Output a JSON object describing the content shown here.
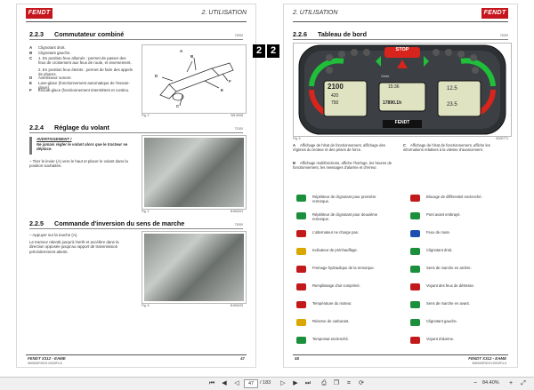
{
  "left_page": {
    "header_logo": "FENDT",
    "header_chapter": "2. UTILISATION",
    "sec1": {
      "num": "2.2.3",
      "title": "Commutateur combiné",
      "code": "72000",
      "items": [
        {
          "k": "A",
          "t": "Clignotant droit."
        },
        {
          "k": "B",
          "t": "Clignotant gauche."
        },
        {
          "k": "C",
          "t": "1. En position feux allumés : permet de passer des feux de croisement aux feux de route, et inversement."
        },
        {
          "k": "",
          "t": "2. En position feux éteints : permet de faire des appels de phares."
        },
        {
          "k": "D",
          "t": "Avertisseur sonore."
        },
        {
          "k": "E",
          "t": "Lave-glace (fonctionnement automatique de l'essuie-glace)."
        },
        {
          "k": "F",
          "t": "Essuie-glace (fonctionnement intermittent et continu."
        }
      ],
      "fig": "Fig. 2",
      "fig_code": "W5-5008",
      "labels": [
        "A",
        "B",
        "C",
        "D",
        "E",
        "F"
      ]
    },
    "sec2": {
      "num": "2.2.4",
      "title": "Réglage du volant",
      "code": "72100",
      "warn_title": "AVERTISSEMENT !",
      "warn_text": "Ne jamais régler le volant alors que le tracteur se déplace.",
      "step": "Tirer le levier (A) vers le haut et placer le volant dans la position souhaitée.",
      "fig": "Fig. 4",
      "fig_code": "B1B0024"
    },
    "sec3": {
      "num": "2.2.5",
      "title": "Commande d'inversion du sens de marche",
      "code": "72000",
      "step": "Appuyer sur la touche (A).",
      "text": "Le tracteur ralentit jusqu'à l'arrêt et accélère dans la direction opposée jusqu'au rapport de transmission précédemment atteint.",
      "fig": "Fig. 5",
      "fig_code": "B1B0025"
    },
    "footer_model": "FENDT X312 - EAME",
    "footer_sub": "3M0000F00X3 2003/F4-5",
    "page_num": "47"
  },
  "right_page": {
    "header_chapter": "2. UTILISATION",
    "header_logo": "FENDT",
    "chapter_tab": "2",
    "sec": {
      "num": "2.2.6",
      "title": "Tableau de bord",
      "code": "72000"
    },
    "dashboard": {
      "stop": "STOP",
      "brand": "FENDT",
      "left_display": [
        "2100",
        "420",
        "750"
      ],
      "center_display": [
        "15:36",
        "17890.1h"
      ],
      "right_display": [
        "12.5",
        "23.5"
      ],
      "vario": "Vario"
    },
    "fig": "Fig. 6",
    "fig_code": "B000771",
    "desc": {
      "A": "Affichage de l'état de fonctionnement, affichage des régimes du moteur et des prises de force.",
      "B": "Affichage multifonctions, affiche l'horloge, les heures de fonctionnement, les messages d'alarme et d'erreur.",
      "C": "Affichage de l'état de fonctionnement, affiche les informations relatives à la vitesse d'avancement."
    },
    "legend_left": [
      {
        "t": "Répétiteur de clignotant pour première remorque.",
        "c": "#1c8f3c",
        "k": "arrow-left-icon"
      },
      {
        "t": "Répétiteur de clignotant pour deuxième remorque.",
        "c": "#1c8f3c",
        "k": "arrow-left-icon"
      },
      {
        "t": "L'alternateur ne charge pas.",
        "c": "#c21a1a",
        "k": "battery-icon"
      },
      {
        "t": "Indicateur de préchauffage.",
        "c": "#d9a700",
        "k": "coil-icon"
      },
      {
        "t": "Freinage hydraulique de la remorque.",
        "c": "#c21a1a",
        "k": "brake-icon"
      },
      {
        "t": "Remplissage d'air comprimé.",
        "c": "#c21a1a",
        "k": "air-icon"
      },
      {
        "t": "Température du moteur.",
        "c": "#c21a1a",
        "k": "temperature-icon"
      },
      {
        "t": "Réserve de carburant.",
        "c": "#d9a700",
        "k": "fuel-icon"
      },
      {
        "t": "Tempomat enclenché.",
        "c": "#1c8f3c",
        "k": "tempomat-icon"
      }
    ],
    "legend_right": [
      {
        "t": "Blocage de différentiel enclenché.",
        "c": "#c21a1a",
        "k": "diff-lock-icon"
      },
      {
        "t": "Pont avant embrayé.",
        "c": "#1c8f3c",
        "k": "front-axle-icon"
      },
      {
        "t": "Feux de route.",
        "c": "#1d4fb0",
        "k": "high-beam-icon"
      },
      {
        "t": "Clignotant droit.",
        "c": "#1c8f3c",
        "k": "arrow-right-icon"
      },
      {
        "t": "Sens de marche en arrière.",
        "c": "#1c8f3c",
        "k": "arrow-down-icon"
      },
      {
        "t": "Voyant des feux de détresse.",
        "c": "#c21a1a",
        "k": "hazard-icon"
      },
      {
        "t": "Sens de marche en avant.",
        "c": "#1c8f3c",
        "k": "arrow-up-icon"
      },
      {
        "t": "Clignotant gauche.",
        "c": "#1c8f3c",
        "k": "arrow-left-icon"
      },
      {
        "t": "Voyant d'alarme.",
        "c": "#c21a1a",
        "k": "stop-icon"
      }
    ],
    "footer_num": "48",
    "footer_model": "FENDT X312 - EAME",
    "footer_sub": "3M0000F00X3 2003/F4-5"
  },
  "toolbar": {
    "page_current": "47",
    "page_total": "/ 183",
    "zoom": "84.40%"
  }
}
